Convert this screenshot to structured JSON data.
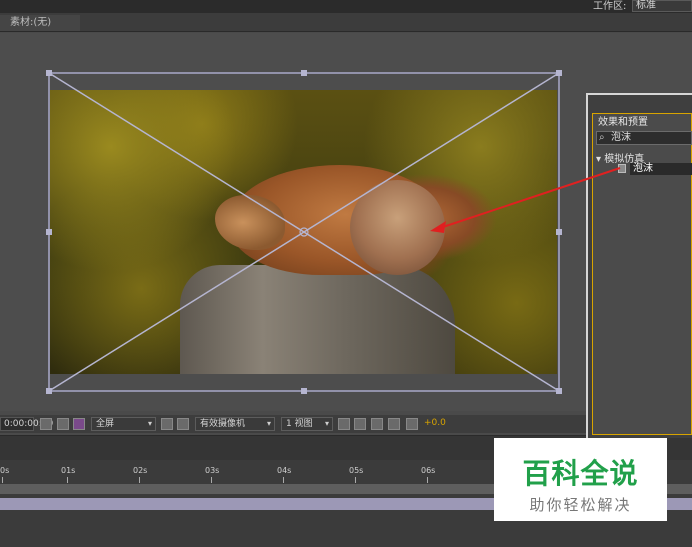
{
  "topbar": {
    "workspace_label": "工作区:",
    "workspace_value": "标准"
  },
  "source_panel": {
    "tab_label": "素材:(无)"
  },
  "viewer_toolbar": {
    "timecode": "0:00:00:00",
    "resolution": "全屏",
    "camera": "有效摄像机",
    "view_layout": "1 视图",
    "exposure": "+0.0"
  },
  "timeline": {
    "ticks": [
      "0s",
      "01s",
      "02s",
      "03s",
      "04s",
      "05s",
      "06s"
    ]
  },
  "effects_panel": {
    "tab_label": "效果和预置",
    "search_value": "泡沫",
    "category": "模拟仿真",
    "item": "泡沫"
  },
  "watermark": {
    "title": "百科全说",
    "subtitle": "助你轻松解决"
  },
  "colors": {
    "accent": "#d8a400",
    "annotation_arrow": "#e02020",
    "watermark_green": "#21a04a"
  }
}
